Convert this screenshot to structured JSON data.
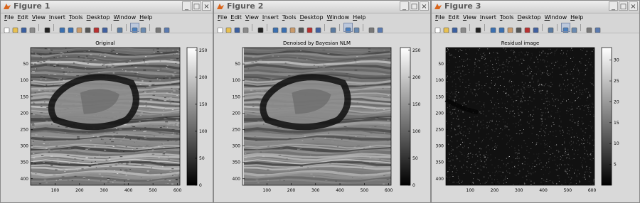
{
  "menu": [
    "File",
    "Edit",
    "View",
    "Insert",
    "Tools",
    "Desktop",
    "Window",
    "Help"
  ],
  "windows": [
    {
      "title": "Figure 1",
      "axes_title": "Original",
      "image_kind": "ultrasound",
      "colorbar_ticks": [
        "250",
        "200",
        "150",
        "100",
        "50",
        "0"
      ],
      "y_ticks": [
        "50",
        "100",
        "150",
        "200",
        "250",
        "300",
        "350",
        "400"
      ],
      "x_ticks": [
        "100",
        "200",
        "300",
        "400",
        "500",
        "600"
      ]
    },
    {
      "title": "Figure 2",
      "axes_title": "Denoised by Bayesian NLM",
      "image_kind": "ultrasound-smooth",
      "colorbar_ticks": [
        "250",
        "200",
        "150",
        "100",
        "50",
        "0"
      ],
      "y_ticks": [
        "50",
        "100",
        "150",
        "200",
        "250",
        "300",
        "350",
        "400"
      ],
      "x_ticks": [
        "100",
        "200",
        "300",
        "400",
        "500",
        "600"
      ]
    },
    {
      "title": "Figure 3",
      "axes_title": "Residual image",
      "image_kind": "residual",
      "colorbar_ticks": [
        "30",
        "25",
        "20",
        "15",
        "10",
        "5"
      ],
      "y_ticks": [
        "50",
        "100",
        "150",
        "200",
        "250",
        "300",
        "350",
        "400"
      ],
      "x_ticks": [
        "100",
        "200",
        "300",
        "400",
        "500",
        "600"
      ]
    }
  ],
  "window_buttons": [
    "_",
    "□",
    "×"
  ],
  "toolbar_icons": [
    "new-file-icon",
    "open-folder-icon",
    "save-icon",
    "print-icon",
    "sep",
    "pointer-icon",
    "sep",
    "zoom-in-icon",
    "zoom-out-icon",
    "pan-hand-icon",
    "rotate-3d-icon",
    "data-cursor-icon",
    "brush-icon",
    "sep",
    "link-plot-icon",
    "sep",
    "colorbar-icon",
    "legend-icon",
    "sep",
    "hide-tools-icon",
    "show-tools-icon"
  ]
}
